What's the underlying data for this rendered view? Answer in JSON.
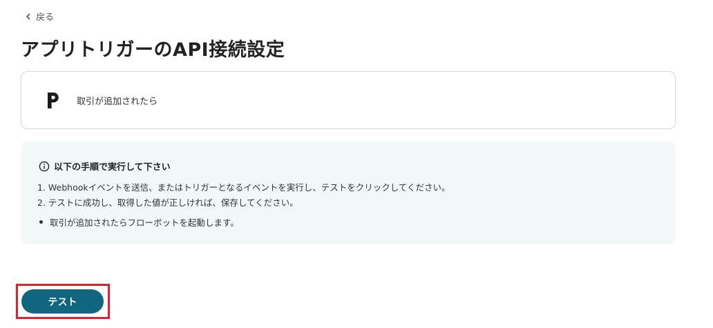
{
  "header": {
    "back_label": "戻る",
    "title": "アプリトリガーのAPI接続設定"
  },
  "trigger": {
    "app_logo_icon": "pipedrive-p-logo",
    "app_logo_letter": "p",
    "label": "取引が追加されたら"
  },
  "instructions": {
    "icon": "info-circle-icon",
    "heading": "以下の手順で実行して下さい",
    "steps": [
      "1. Webhookイベントを送信、またはトリガーとなるイベントを実行し、テストをクリックしてください。",
      "2. テストに成功し、取得した値が正しければ、保存してください。"
    ],
    "notes": [
      "取引が追加されたらフローボットを起動します。"
    ]
  },
  "actions": {
    "test_label": "テスト"
  },
  "colors": {
    "primary_button": "#10667f",
    "highlight_border": "#e0202c",
    "info_background": "#f2f8f8",
    "card_border": "#d3d7db"
  }
}
